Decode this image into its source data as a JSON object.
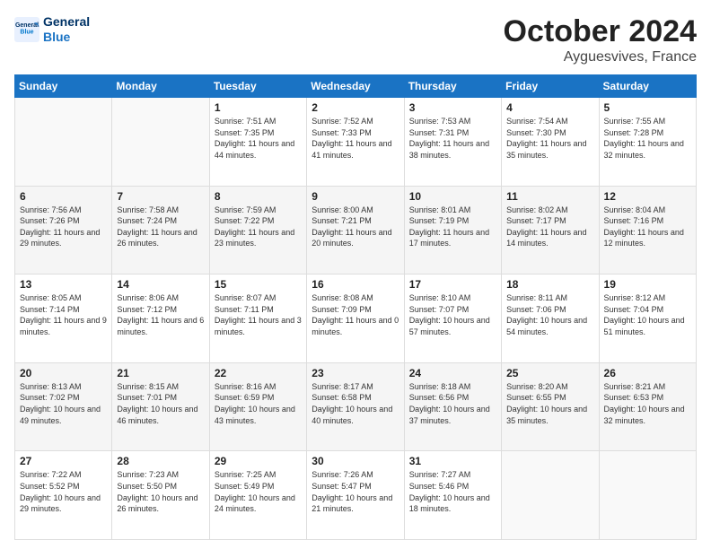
{
  "logo": {
    "line1": "General",
    "line2": "Blue"
  },
  "title": "October 2024",
  "subtitle": "Ayguesvives, France",
  "weekdays": [
    "Sunday",
    "Monday",
    "Tuesday",
    "Wednesday",
    "Thursday",
    "Friday",
    "Saturday"
  ],
  "weeks": [
    [
      {
        "day": "",
        "info": ""
      },
      {
        "day": "",
        "info": ""
      },
      {
        "day": "1",
        "info": "Sunrise: 7:51 AM\nSunset: 7:35 PM\nDaylight: 11 hours and 44 minutes."
      },
      {
        "day": "2",
        "info": "Sunrise: 7:52 AM\nSunset: 7:33 PM\nDaylight: 11 hours and 41 minutes."
      },
      {
        "day": "3",
        "info": "Sunrise: 7:53 AM\nSunset: 7:31 PM\nDaylight: 11 hours and 38 minutes."
      },
      {
        "day": "4",
        "info": "Sunrise: 7:54 AM\nSunset: 7:30 PM\nDaylight: 11 hours and 35 minutes."
      },
      {
        "day": "5",
        "info": "Sunrise: 7:55 AM\nSunset: 7:28 PM\nDaylight: 11 hours and 32 minutes."
      }
    ],
    [
      {
        "day": "6",
        "info": "Sunrise: 7:56 AM\nSunset: 7:26 PM\nDaylight: 11 hours and 29 minutes."
      },
      {
        "day": "7",
        "info": "Sunrise: 7:58 AM\nSunset: 7:24 PM\nDaylight: 11 hours and 26 minutes."
      },
      {
        "day": "8",
        "info": "Sunrise: 7:59 AM\nSunset: 7:22 PM\nDaylight: 11 hours and 23 minutes."
      },
      {
        "day": "9",
        "info": "Sunrise: 8:00 AM\nSunset: 7:21 PM\nDaylight: 11 hours and 20 minutes."
      },
      {
        "day": "10",
        "info": "Sunrise: 8:01 AM\nSunset: 7:19 PM\nDaylight: 11 hours and 17 minutes."
      },
      {
        "day": "11",
        "info": "Sunrise: 8:02 AM\nSunset: 7:17 PM\nDaylight: 11 hours and 14 minutes."
      },
      {
        "day": "12",
        "info": "Sunrise: 8:04 AM\nSunset: 7:16 PM\nDaylight: 11 hours and 12 minutes."
      }
    ],
    [
      {
        "day": "13",
        "info": "Sunrise: 8:05 AM\nSunset: 7:14 PM\nDaylight: 11 hours and 9 minutes."
      },
      {
        "day": "14",
        "info": "Sunrise: 8:06 AM\nSunset: 7:12 PM\nDaylight: 11 hours and 6 minutes."
      },
      {
        "day": "15",
        "info": "Sunrise: 8:07 AM\nSunset: 7:11 PM\nDaylight: 11 hours and 3 minutes."
      },
      {
        "day": "16",
        "info": "Sunrise: 8:08 AM\nSunset: 7:09 PM\nDaylight: 11 hours and 0 minutes."
      },
      {
        "day": "17",
        "info": "Sunrise: 8:10 AM\nSunset: 7:07 PM\nDaylight: 10 hours and 57 minutes."
      },
      {
        "day": "18",
        "info": "Sunrise: 8:11 AM\nSunset: 7:06 PM\nDaylight: 10 hours and 54 minutes."
      },
      {
        "day": "19",
        "info": "Sunrise: 8:12 AM\nSunset: 7:04 PM\nDaylight: 10 hours and 51 minutes."
      }
    ],
    [
      {
        "day": "20",
        "info": "Sunrise: 8:13 AM\nSunset: 7:02 PM\nDaylight: 10 hours and 49 minutes."
      },
      {
        "day": "21",
        "info": "Sunrise: 8:15 AM\nSunset: 7:01 PM\nDaylight: 10 hours and 46 minutes."
      },
      {
        "day": "22",
        "info": "Sunrise: 8:16 AM\nSunset: 6:59 PM\nDaylight: 10 hours and 43 minutes."
      },
      {
        "day": "23",
        "info": "Sunrise: 8:17 AM\nSunset: 6:58 PM\nDaylight: 10 hours and 40 minutes."
      },
      {
        "day": "24",
        "info": "Sunrise: 8:18 AM\nSunset: 6:56 PM\nDaylight: 10 hours and 37 minutes."
      },
      {
        "day": "25",
        "info": "Sunrise: 8:20 AM\nSunset: 6:55 PM\nDaylight: 10 hours and 35 minutes."
      },
      {
        "day": "26",
        "info": "Sunrise: 8:21 AM\nSunset: 6:53 PM\nDaylight: 10 hours and 32 minutes."
      }
    ],
    [
      {
        "day": "27",
        "info": "Sunrise: 7:22 AM\nSunset: 5:52 PM\nDaylight: 10 hours and 29 minutes."
      },
      {
        "day": "28",
        "info": "Sunrise: 7:23 AM\nSunset: 5:50 PM\nDaylight: 10 hours and 26 minutes."
      },
      {
        "day": "29",
        "info": "Sunrise: 7:25 AM\nSunset: 5:49 PM\nDaylight: 10 hours and 24 minutes."
      },
      {
        "day": "30",
        "info": "Sunrise: 7:26 AM\nSunset: 5:47 PM\nDaylight: 10 hours and 21 minutes."
      },
      {
        "day": "31",
        "info": "Sunrise: 7:27 AM\nSunset: 5:46 PM\nDaylight: 10 hours and 18 minutes."
      },
      {
        "day": "",
        "info": ""
      },
      {
        "day": "",
        "info": ""
      }
    ]
  ]
}
